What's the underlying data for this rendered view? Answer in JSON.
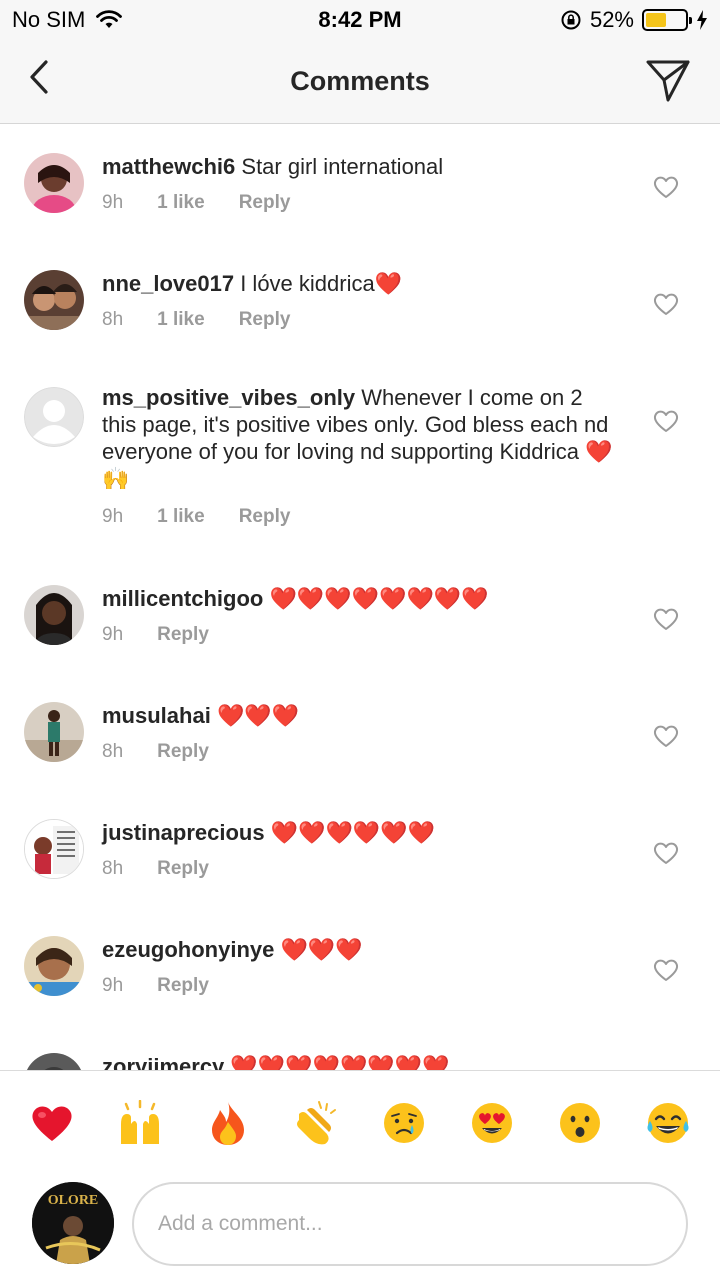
{
  "status_bar": {
    "carrier": "No SIM",
    "time": "8:42 PM",
    "battery_percent": "52%",
    "battery_level": 0.52,
    "icons": [
      "wifi-icon",
      "rotation-lock-icon",
      "battery-icon",
      "charging-bolt-icon"
    ]
  },
  "header": {
    "title": "Comments",
    "back_icon": "chevron-left-icon",
    "send_icon": "paper-plane-icon"
  },
  "comments": [
    {
      "username": "matthewchi6",
      "text": "Star girl international",
      "time": "9h",
      "likes": "1 like",
      "reply": "Reply"
    },
    {
      "username": "nne_love017",
      "text": "I lóve kiddrica❤️",
      "time": "8h",
      "likes": "1 like",
      "reply": "Reply"
    },
    {
      "username": "ms_positive_vibes_only",
      "text": "Whenever I come on 2 this page, it's positive vibes only. God bless each nd everyone of you for loving nd supporting Kiddrica ❤️🙌",
      "time": "9h",
      "likes": "1 like",
      "reply": "Reply"
    },
    {
      "username": "millicentchigoo",
      "text": "❤️❤️❤️❤️❤️❤️❤️❤️",
      "time": "9h",
      "likes": "",
      "reply": "Reply"
    },
    {
      "username": "musulahai",
      "text": "❤️❤️❤️",
      "time": "8h",
      "likes": "",
      "reply": "Reply"
    },
    {
      "username": "justinaprecious",
      "text": "❤️❤️❤️❤️❤️❤️",
      "time": "8h",
      "likes": "",
      "reply": "Reply"
    },
    {
      "username": "ezeugohonyinye",
      "text": "❤️❤️❤️",
      "time": "9h",
      "likes": "",
      "reply": "Reply"
    },
    {
      "username": "zoryiimercy",
      "text": "❤️❤️❤️❤️❤️❤️❤️❤️",
      "time": "",
      "likes": "",
      "reply": ""
    }
  ],
  "reactions": [
    "❤️",
    "🙌",
    "🔥",
    "👏",
    "😢",
    "😍",
    "😮",
    "😂"
  ],
  "composer": {
    "placeholder": "Add a comment...",
    "avatar_text": "OLORE"
  },
  "colors": {
    "accent_heart": "#e5152d",
    "meta_gray": "#9a9a9a",
    "header_bg": "#f7f7f7",
    "battery_yellow": "#f4c41a"
  }
}
